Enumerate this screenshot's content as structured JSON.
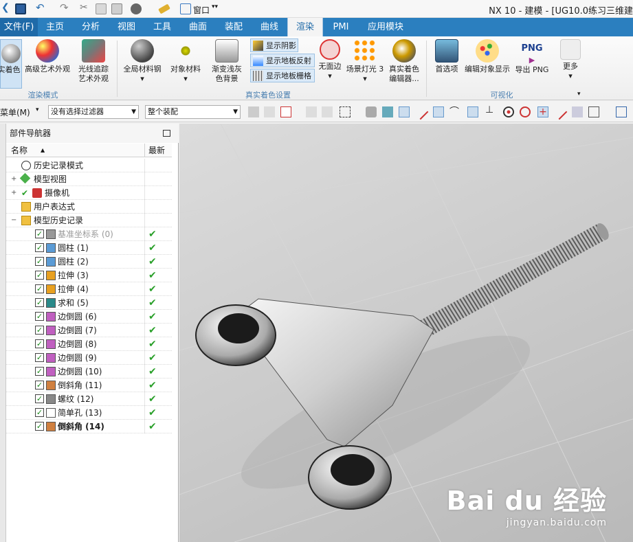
{
  "window": {
    "title": "NX 10 - 建模 - [UG10.0练习三维建",
    "menu_window": "窗口"
  },
  "tabs": [
    "文件(F)",
    "主页",
    "分析",
    "视图",
    "工具",
    "曲面",
    "装配",
    "曲线",
    "渲染",
    "PMI",
    "应用模块"
  ],
  "active_tab": "渲染",
  "ribbon": {
    "buttons": {
      "real_shading": "实着色",
      "adv_art": "高级艺术外观",
      "raytrace_1": "光线追踪",
      "raytrace_2": "艺术外观",
      "global_material": "全局材料钢",
      "object_material": "对象材料",
      "gradient_1": "渐变浅灰",
      "gradient_2": "色背景",
      "no_edge": "无面边",
      "scene_light": "场景灯光 3",
      "shade_editor_1": "真实着色",
      "shade_editor_2": "编辑器...",
      "preferences": "首选项",
      "edit_display": "编辑对象显示",
      "export_png": "导出 PNG",
      "png_badge": "PNG",
      "more": "更多"
    },
    "toggles": {
      "show_shadow": "显示阴影",
      "floor_reflection": "显示地板反射",
      "floor_grid": "显示地板栅格"
    },
    "groups": {
      "render_mode": "渲染模式",
      "real_shading_settings": "真实着色设置",
      "visualization": "可视化"
    }
  },
  "toolbar": {
    "menu": "菜单(M)",
    "filter": "没有选择过滤器",
    "assembly": "整个装配"
  },
  "navigator": {
    "title": "部件导航器",
    "col_name": "名称",
    "col_latest": "最新",
    "top_nodes": [
      "历史记录模式",
      "模型视图",
      "摄像机",
      "用户表达式",
      "模型历史记录"
    ],
    "features": [
      {
        "label": "基准坐标系 (0)",
        "dim": true,
        "bold": false
      },
      {
        "label": "圆柱 (1)",
        "dim": false,
        "bold": false
      },
      {
        "label": "圆柱 (2)",
        "dim": false,
        "bold": false
      },
      {
        "label": "拉伸 (3)",
        "dim": false,
        "bold": false
      },
      {
        "label": "拉伸 (4)",
        "dim": false,
        "bold": false
      },
      {
        "label": "求和 (5)",
        "dim": false,
        "bold": false
      },
      {
        "label": "边倒圆 (6)",
        "dim": false,
        "bold": false
      },
      {
        "label": "边倒圆 (7)",
        "dim": false,
        "bold": false
      },
      {
        "label": "边倒圆 (8)",
        "dim": false,
        "bold": false
      },
      {
        "label": "边倒圆 (9)",
        "dim": false,
        "bold": false
      },
      {
        "label": "边倒圆 (10)",
        "dim": false,
        "bold": false
      },
      {
        "label": "倒斜角 (11)",
        "dim": false,
        "bold": false
      },
      {
        "label": "螺纹 (12)",
        "dim": false,
        "bold": false
      },
      {
        "label": "简单孔 (13)",
        "dim": false,
        "bold": false
      },
      {
        "label": "倒斜角 (14)",
        "dim": false,
        "bold": true
      }
    ]
  },
  "watermark": {
    "brand": "Bai du 经验",
    "url": "jingyan.baidu.com"
  },
  "colors": {
    "ribbon_blue": "#2b7fbf",
    "check_green": "#2aa02a"
  }
}
